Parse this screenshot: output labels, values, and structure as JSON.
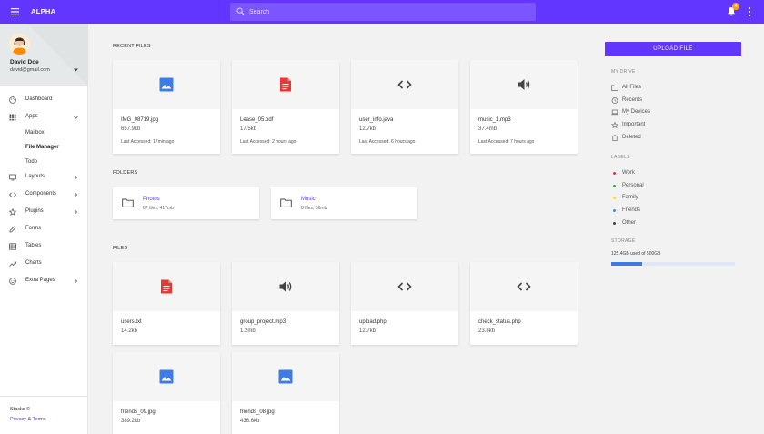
{
  "brand": "ALPHA",
  "search": {
    "placeholder": "Search"
  },
  "notifications": {
    "count": "4"
  },
  "colors": {
    "accent": "#6236ff",
    "topbar": "#6236ff",
    "image_icon": "#3d7be5",
    "pdf_icon": "#e53935",
    "storage_fill": "#3d7be5"
  },
  "user": {
    "name": "David Doe",
    "email": "david@gmail.com"
  },
  "nav": [
    {
      "label": "Dashboard",
      "icon": "palette-icon"
    },
    {
      "label": "Apps",
      "icon": "apps-grid-icon",
      "expanded": true
    },
    {
      "label": "Layouts",
      "icon": "monitor-icon"
    },
    {
      "label": "Components",
      "icon": "code-icon"
    },
    {
      "label": "Plugins",
      "icon": "star-icon"
    },
    {
      "label": "Forms",
      "icon": "edit-icon"
    },
    {
      "label": "Tables",
      "icon": "table-icon"
    },
    {
      "label": "Charts",
      "icon": "trend-icon"
    },
    {
      "label": "Extra Pages",
      "icon": "smiley-icon"
    }
  ],
  "apps_sub": [
    "Mailbox",
    "File Manager",
    "Todo"
  ],
  "footer": {
    "text": "Stacks ©",
    "privacy": "Privacy",
    "amp": "&",
    "terms": "Terms"
  },
  "sections": {
    "recent": "RECENT FILES",
    "folders": "FOLDERS",
    "files": "FILES"
  },
  "recent_files": [
    {
      "name": "IMG_08719.jpg",
      "size": "657.9kb",
      "access": "Last Accessed: 17min ago",
      "icon": "image-icon"
    },
    {
      "name": "Lease_05.pdf",
      "size": "17.5kb",
      "access": "Last Accessed: 2 hours ago",
      "icon": "pdf-file-icon"
    },
    {
      "name": "user_info.java",
      "size": "12.7kb",
      "access": "Last Accessed: 6 hours ago",
      "icon": "code-icon"
    },
    {
      "name": "music_1.mp3",
      "size": "37.4mb",
      "access": "Last Accessed: 7 hours ago",
      "icon": "audio-icon"
    }
  ],
  "folders": [
    {
      "name": "Photos",
      "meta": "87 files, 417mb"
    },
    {
      "name": "Music",
      "meta": "8 files, 56mb"
    }
  ],
  "files": [
    {
      "name": "users.txt",
      "size": "14.2kb",
      "icon": "text-file-icon"
    },
    {
      "name": "group_project.mp3",
      "size": "1.2mb",
      "icon": "audio-icon"
    },
    {
      "name": "upload.php",
      "size": "12.7kb",
      "icon": "code-icon"
    },
    {
      "name": "check_status.php",
      "size": "23.8kb",
      "icon": "code-icon"
    },
    {
      "name": "friends_09.jpg",
      "size": "389.2kb",
      "icon": "image-icon"
    },
    {
      "name": "friends_08.jpg",
      "size": "436.6kb",
      "icon": "image-icon"
    }
  ],
  "right": {
    "upload": "UPLOAD FILE",
    "my_drive_title": "MY DRIVE",
    "drive_items": [
      {
        "label": "All Files",
        "icon": "folder-icon"
      },
      {
        "label": "Recents",
        "icon": "clock-icon"
      },
      {
        "label": "My Devices",
        "icon": "laptop-icon"
      },
      {
        "label": "Important",
        "icon": "star-icon"
      },
      {
        "label": "Deleted",
        "icon": "trash-icon"
      }
    ],
    "labels_title": "LABELS",
    "labels": [
      {
        "label": "Work",
        "color": "#e53935"
      },
      {
        "label": "Personal",
        "color": "#43a047"
      },
      {
        "label": "Family",
        "color": "#fdd835"
      },
      {
        "label": "Friends",
        "color": "#2196f3"
      },
      {
        "label": "Other",
        "color": "#424242"
      }
    ],
    "storage_title": "STORAGE",
    "storage_text": "125.4GB used of 500GB",
    "storage_fraction": 0.25
  }
}
